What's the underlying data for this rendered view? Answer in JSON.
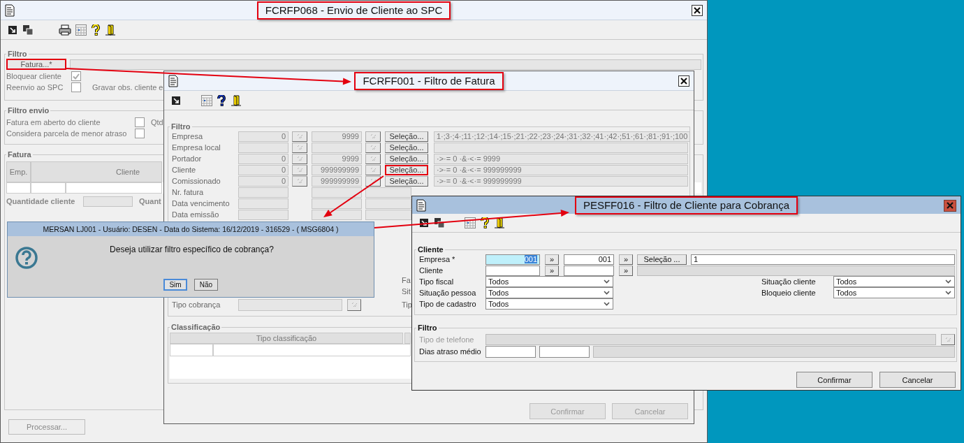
{
  "main_window": {
    "title": "FCRFP068 - Envio de Cliente ao SPC",
    "title_highlighted": true,
    "filtro": {
      "legend": "Filtro",
      "fatura_button": {
        "label": "Fatura...*",
        "highlighted": true
      },
      "checks": [
        {
          "label": "Bloquear cliente",
          "checked": true
        },
        {
          "label": "Reenvio ao SPC",
          "checked": false
        }
      ],
      "gravar_label": "Gravar obs. cliente e"
    },
    "filtro_envio": {
      "legend": "Filtro envio",
      "checks": [
        {
          "label": "Fatura em aberto do cliente",
          "checked": false
        },
        {
          "label": "Considera parcela de menor atraso",
          "checked": false
        }
      ],
      "qtd_label": "Qtd"
    },
    "fatura": {
      "legend": "Fatura",
      "columns": [
        "Emp.",
        "Cliente"
      ],
      "quantidade_label": "Quantidade cliente",
      "quant_label": "Quant"
    },
    "process_button": "Processar..."
  },
  "filter_window": {
    "title": "FCRFF001 - Filtro de Fatura",
    "title_highlighted": true,
    "legend": "Filtro",
    "rows": [
      {
        "kind": "range",
        "label": "Empresa",
        "from": "0",
        "to": "9999",
        "selection": "Seleção...",
        "selection_highlighted": false,
        "summary": "1·;3·;4·;11·;12·;14·;15·;21·;22·;23·;24·;31·;32·;41·;42·;51·;61·;81·;91·;100"
      },
      {
        "kind": "range",
        "label": "Empresa local",
        "selection": "Seleção...",
        "selection_highlighted": false
      },
      {
        "kind": "range",
        "label": "Portador",
        "from": "0",
        "to": "9999",
        "selection": "Seleção...",
        "selection_highlighted": false,
        "summary": "·>·= 0 ·&·<·= 9999"
      },
      {
        "kind": "range",
        "label": "Cliente",
        "from": "0",
        "to": "999999999",
        "selection": "Seleção...",
        "selection_highlighted": true,
        "summary": "·>·= 0 ·&·<·= 999999999"
      },
      {
        "kind": "range",
        "label": "Comissionado",
        "from": "0",
        "to": "999999999",
        "selection": "Seleção...",
        "selection_highlighted": false,
        "summary": "·>·= 0 ·&·<·= 999999999"
      },
      {
        "kind": "plain",
        "label": "Nr. fatura"
      },
      {
        "kind": "plain",
        "label": "Data vencimento"
      },
      {
        "kind": "plain",
        "label": "Data emissão"
      }
    ],
    "side_labels": [
      "Fa",
      "Sit",
      "Tip"
    ],
    "tipo_cobranca_label": "Tipo cobrança",
    "classificacao": {
      "legend": "Classificação",
      "columns": [
        "Tipo classificação"
      ]
    },
    "buttons": [
      "Confirmar",
      "Cancelar"
    ]
  },
  "message_dialog": {
    "title": "MERSAN LJ001 - Usuário: DESEN - Data do Sistema: 16/12/2019 - 316529 - ( MSG6804 )",
    "message": "Deseja utilizar filtro específico de cobrança?",
    "buttons": [
      {
        "label": "Sim",
        "focused": true
      },
      {
        "label": "Não",
        "focused": false
      }
    ]
  },
  "client_window": {
    "title": "PESFF016 - Filtro de Cliente para Cobrança",
    "title_highlighted": true,
    "cliente": {
      "legend": "Cliente",
      "empresa": {
        "label": "Empresa *",
        "from": "001",
        "from_focused": true,
        "from_button": "»",
        "to": "001",
        "to_button": "»",
        "selection": "Seleção ...",
        "summary": "1"
      },
      "cliente": {
        "label": "Cliente",
        "from_button": "»",
        "to_button": "»"
      },
      "selects_left": [
        {
          "label": "Tipo fiscal",
          "value": "Todos"
        },
        {
          "label": "Situação pessoa",
          "value": "Todos"
        },
        {
          "label": "Tipo de cadastro",
          "value": "Todos"
        }
      ],
      "selects_right": [
        {
          "label": "Situação cliente",
          "value": "Todos"
        },
        {
          "label": "Bloqueio cliente",
          "value": "Todos"
        }
      ]
    },
    "filtro": {
      "legend": "Filtro",
      "tipo_telefone": {
        "label": "Tipo de telefone",
        "disabled": true
      },
      "dias_atraso_label": "Dias atraso médio"
    },
    "buttons": [
      "Confirmar",
      "Cancelar"
    ]
  }
}
